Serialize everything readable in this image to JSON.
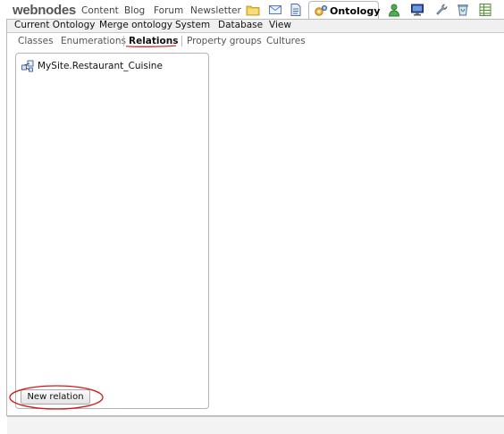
{
  "brand": {
    "logo_text": "webnodes"
  },
  "nav": {
    "links": [
      "Content",
      "Blog",
      "Forum",
      "Newsletter"
    ],
    "active_tab": "Ontology"
  },
  "menubar": {
    "items": [
      "Current Ontology",
      "Merge ontology",
      "System",
      "Database",
      "View"
    ]
  },
  "subtabs": {
    "items": [
      "Classes",
      "Enumerations",
      "Relations",
      "Property groups",
      "Cultures"
    ],
    "selected": "Relations"
  },
  "tree": {
    "items": [
      {
        "label": "MySite.Restaurant_Cuisine",
        "icon": "relation-icon"
      }
    ]
  },
  "actions": {
    "new_relation_label": "New relation"
  },
  "colors": {
    "highlight_red": "#d21919",
    "border": "#b9b9b9",
    "menubar_bg": "#f0f0f0"
  }
}
